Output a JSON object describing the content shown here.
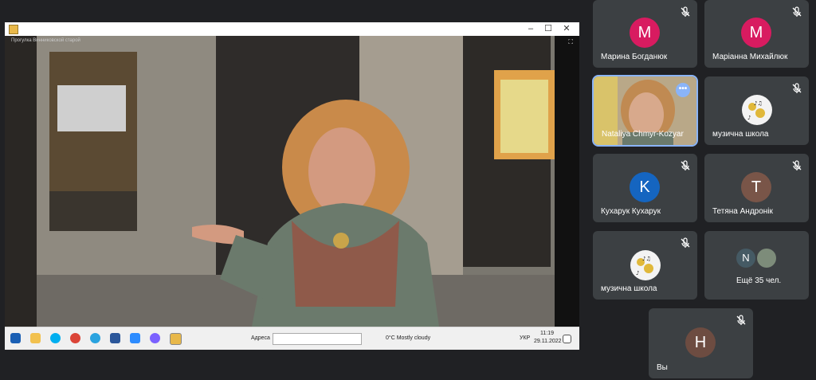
{
  "shared_window": {
    "video_title": "Прогулка Винниковской старой",
    "window_controls": [
      "–",
      "☐",
      "✕"
    ]
  },
  "taskbar": {
    "address_label": "Адреса",
    "weather": "0°C  Mostly cloudy",
    "lang": "УКР",
    "time": "11:19",
    "date": "29.11.2022"
  },
  "participants": [
    {
      "name": "Марина Богданюк",
      "initial": "M",
      "color": "#d81b60",
      "muted": true
    },
    {
      "name": "Маріанна Михайлюк",
      "initial": "M",
      "color": "#d81b60",
      "muted": true
    },
    {
      "name": "Nataliya Chmyr-Kozyar",
      "initial": "",
      "color": "",
      "muted": false,
      "speaking": true
    },
    {
      "name": "музична школа",
      "initial": "",
      "color": "",
      "muted": true
    },
    {
      "name": "Кухарук Кухарук",
      "initial": "K",
      "color": "#1565c0",
      "muted": true
    },
    {
      "name": "Тетяна Андронік",
      "initial": "T",
      "color": "#795548",
      "muted": true
    },
    {
      "name": "музична школа",
      "initial": "",
      "color": "",
      "muted": true
    },
    {
      "name": "Ещё 35 чел.",
      "initial": "N",
      "color": "#455a64",
      "muted": false
    }
  ],
  "self_tile": {
    "name": "Вы",
    "initial": "H",
    "color": "#6d4c41",
    "muted": true
  }
}
